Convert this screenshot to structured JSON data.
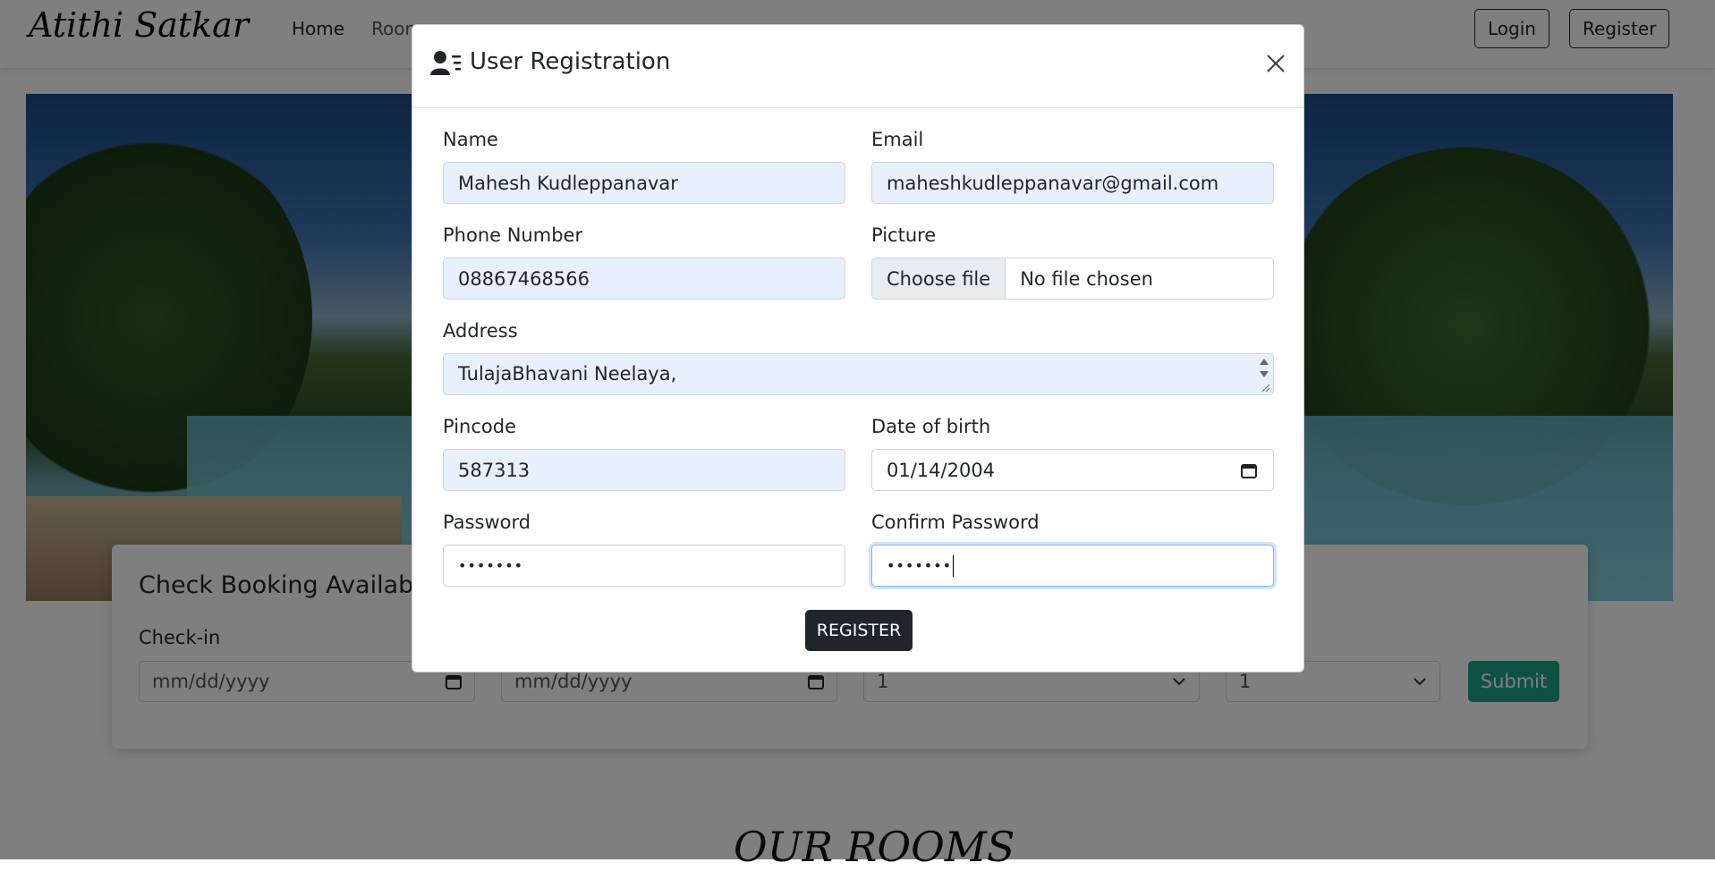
{
  "navbar": {
    "brand": "Atithi Satkar",
    "links": [
      "Home",
      "Room"
    ],
    "login_label": "Login",
    "register_label": "Register"
  },
  "booking": {
    "title": "Check Booking Availabil",
    "checkin_label": "Check-in",
    "checkin_placeholder": "mm/dd/yyyy",
    "checkout_placeholder": "mm/dd/yyyy",
    "adults_value": "1",
    "children_value": "1",
    "submit_label": "Submit"
  },
  "section": {
    "title": "OUR ROOMS"
  },
  "modal": {
    "title": "User Registration",
    "close_icon": "close-icon",
    "user_icon": "user-list-icon",
    "fields": {
      "name": {
        "label": "Name",
        "value": "Mahesh Kudleppanavar"
      },
      "email": {
        "label": "Email",
        "value": "maheshkudleppanavar@gmail.com"
      },
      "phone": {
        "label": "Phone Number",
        "value": "08867468566"
      },
      "picture": {
        "label": "Picture",
        "button": "Choose file",
        "status": "No file chosen"
      },
      "address": {
        "label": "Address",
        "value": "TulajaBhavani Neelaya,"
      },
      "pincode": {
        "label": "Pincode",
        "value": "587313"
      },
      "dob": {
        "label": "Date of birth",
        "value": "01/14/2004"
      },
      "password": {
        "label": "Password",
        "value": "•••••••"
      },
      "confirm_password": {
        "label": "Confirm Password",
        "value": "•••••••"
      }
    },
    "register_label": "REGISTER"
  },
  "colors": {
    "autofill_bg": "#e8f0fe",
    "submit_green": "#1aa38a",
    "dark_button": "#212529"
  }
}
